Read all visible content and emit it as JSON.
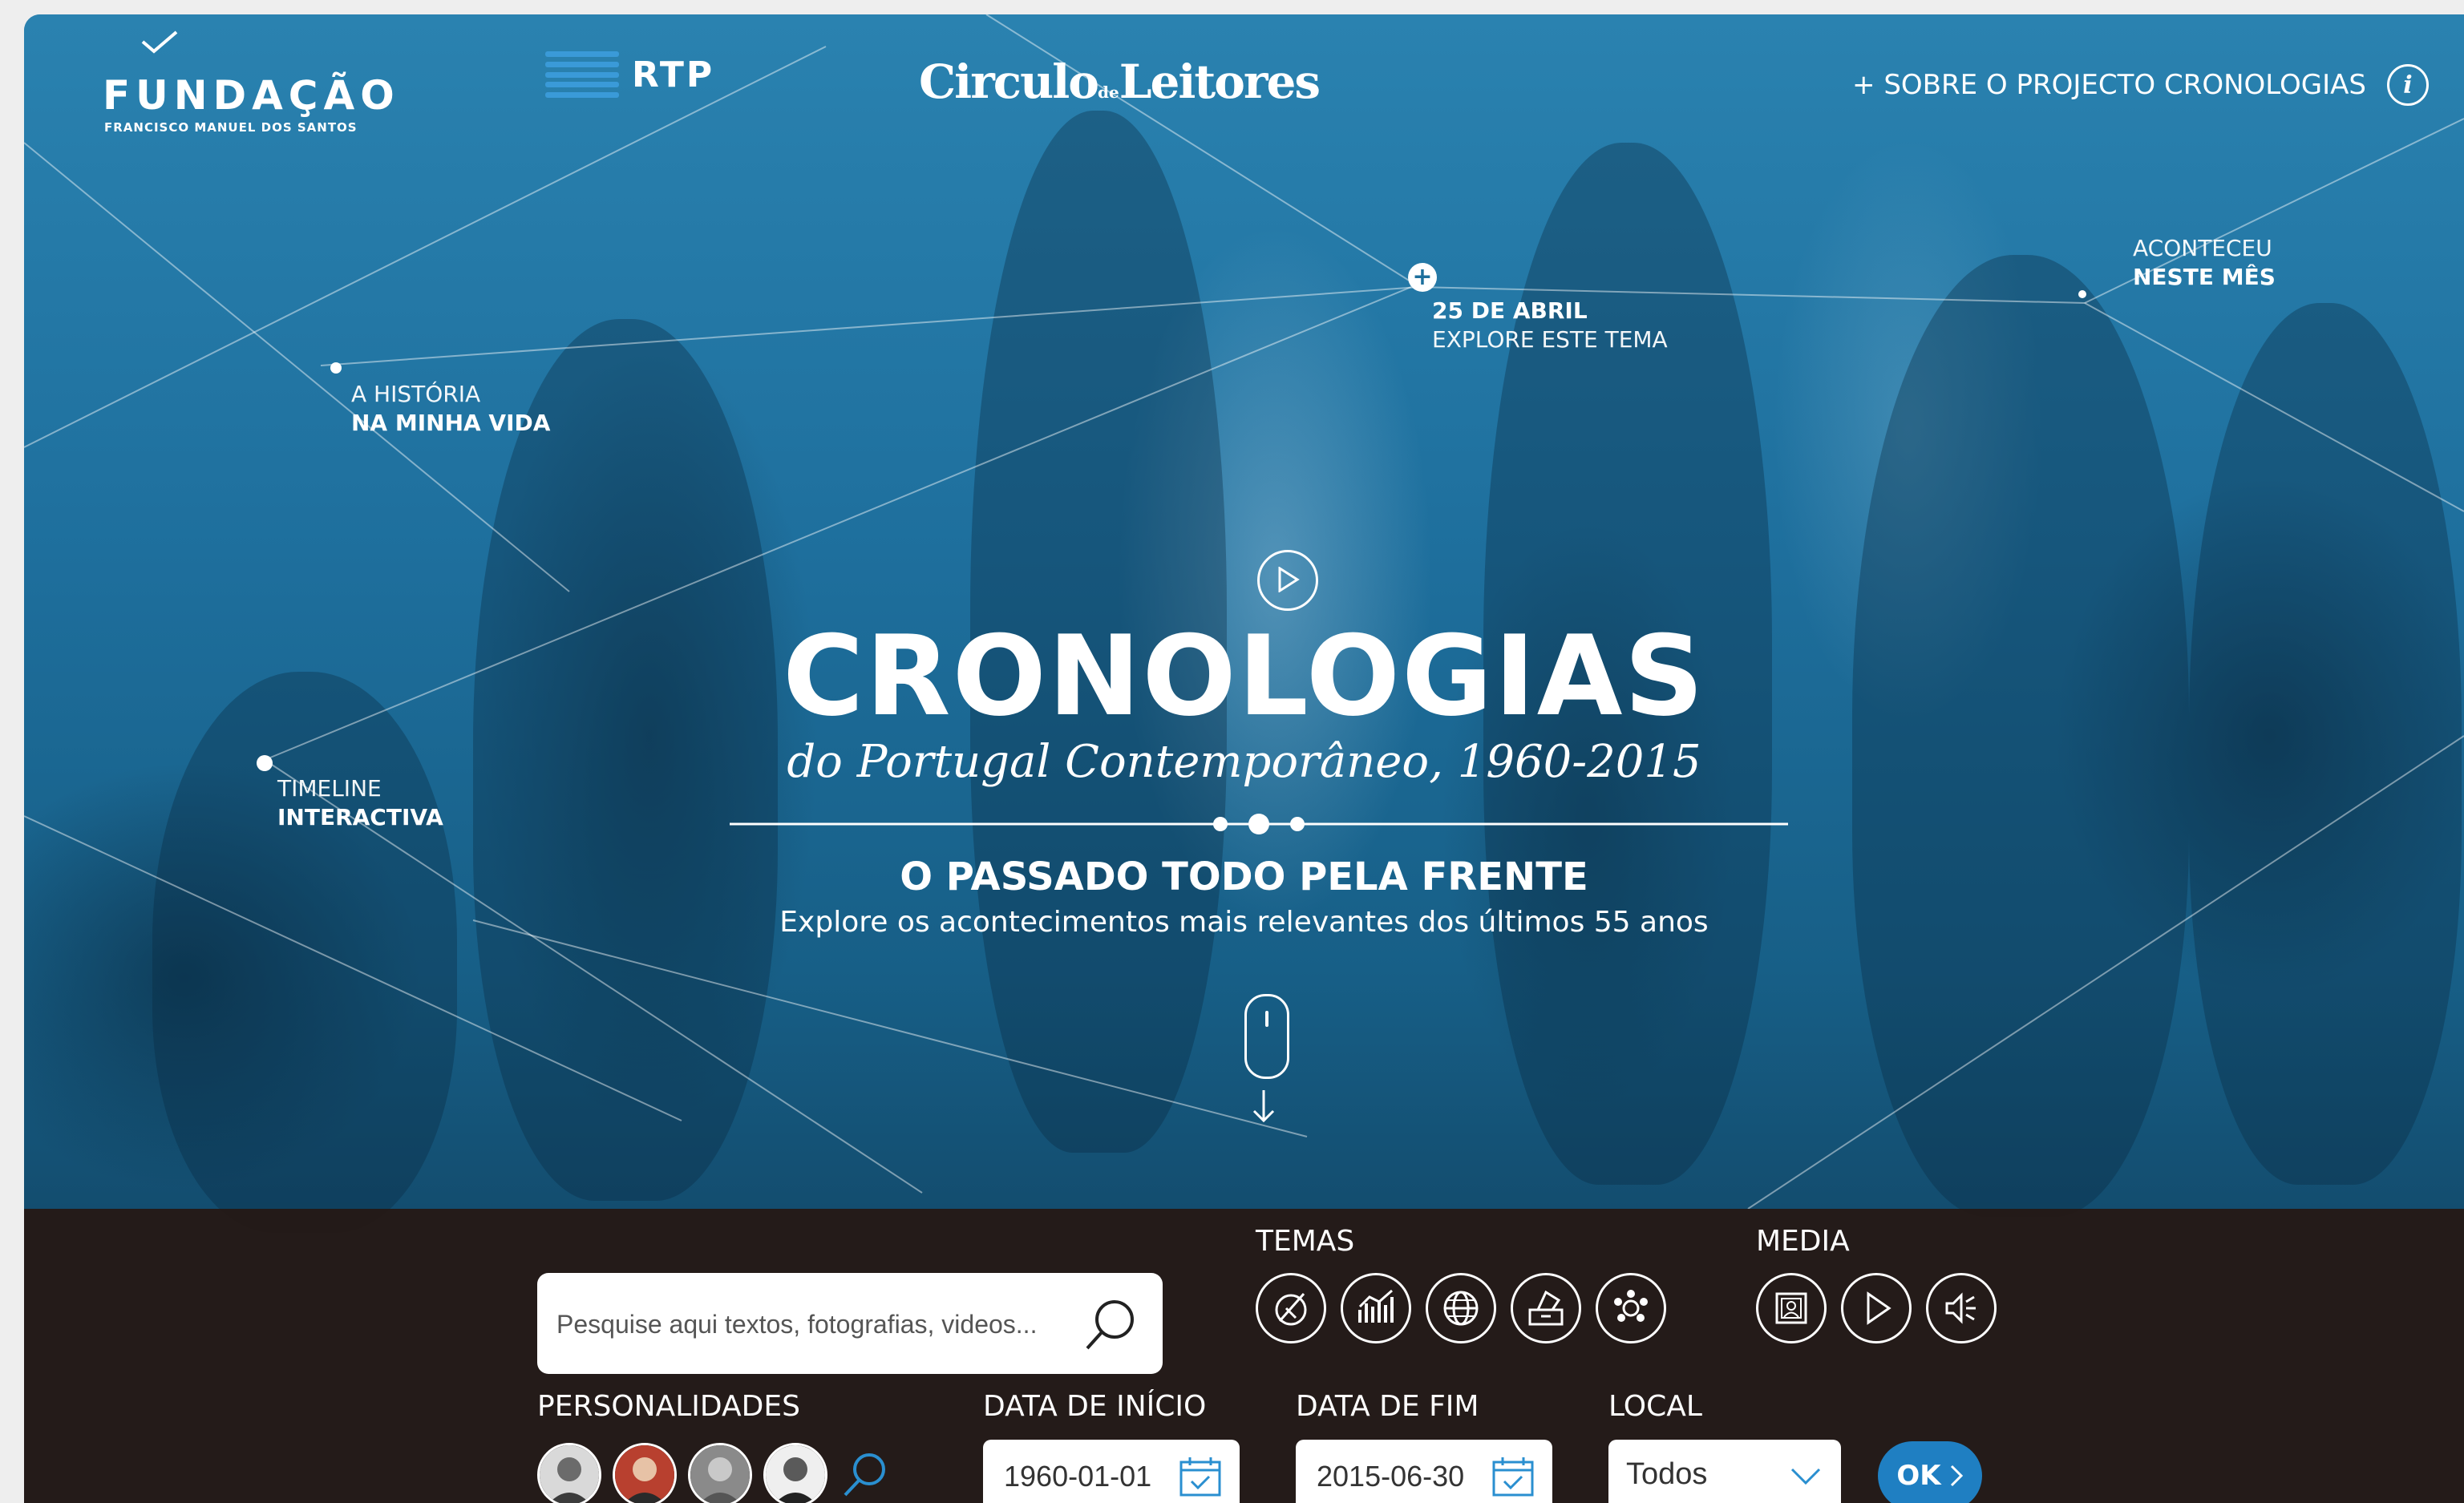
{
  "header": {
    "fundacao_title": "FUNDAÇÃO",
    "fundacao_subtitle": "FRANCISCO MANUEL DOS SANTOS",
    "rtp_label": "RTP",
    "circulo_part1": "Circulo",
    "circulo_de": "de",
    "circulo_part2": "Leitores",
    "about_link": "+ SOBRE O PROJECTO CRONOLOGIAS",
    "info_label": "i"
  },
  "hotspots": {
    "historia": {
      "line1": "A HISTÓRIA",
      "line2": "NA MINHA VIDA"
    },
    "timeline": {
      "line1": "TIMELINE",
      "line2": "INTERACTIVA"
    },
    "abril": {
      "line1": "25 DE ABRIL",
      "line2": "EXPLORE ESTE TEMA",
      "plus": "+"
    },
    "aconteceu": {
      "line1": "ACONTECEU",
      "line2": "NESTE MÊS"
    }
  },
  "hero": {
    "title": "CRONOLOGIAS",
    "subtitle": "do Portugal Contemporâneo, 1960-2015",
    "slogan": "O PASSADO TODO PELA FRENTE",
    "lead": "Explore os acontecimentos mais relevantes dos últimos 55 anos"
  },
  "filters": {
    "search_placeholder": "Pesquise aqui textos, fotografias, videos...",
    "temas_label": "TEMAS",
    "temas_icons": [
      "culture-icon",
      "economy-icon",
      "world-icon",
      "elections-icon",
      "society-icon"
    ],
    "media_label": "MEDIA",
    "media_icons": [
      "photo-icon",
      "video-icon",
      "audio-icon"
    ],
    "personalidades_label": "PERSONALIDADES",
    "data_inicio_label": "DATA DE INÍCIO",
    "data_inicio_value": "1960-01-01",
    "data_fim_label": "DATA DE FIM",
    "data_fim_value": "2015-06-30",
    "local_label": "LOCAL",
    "local_value": "Todos",
    "ok_label": "OK"
  },
  "colors": {
    "hero_tint": "#1c6e99",
    "bar_bg": "#24180f",
    "ok_button": "#1f7fc2"
  }
}
